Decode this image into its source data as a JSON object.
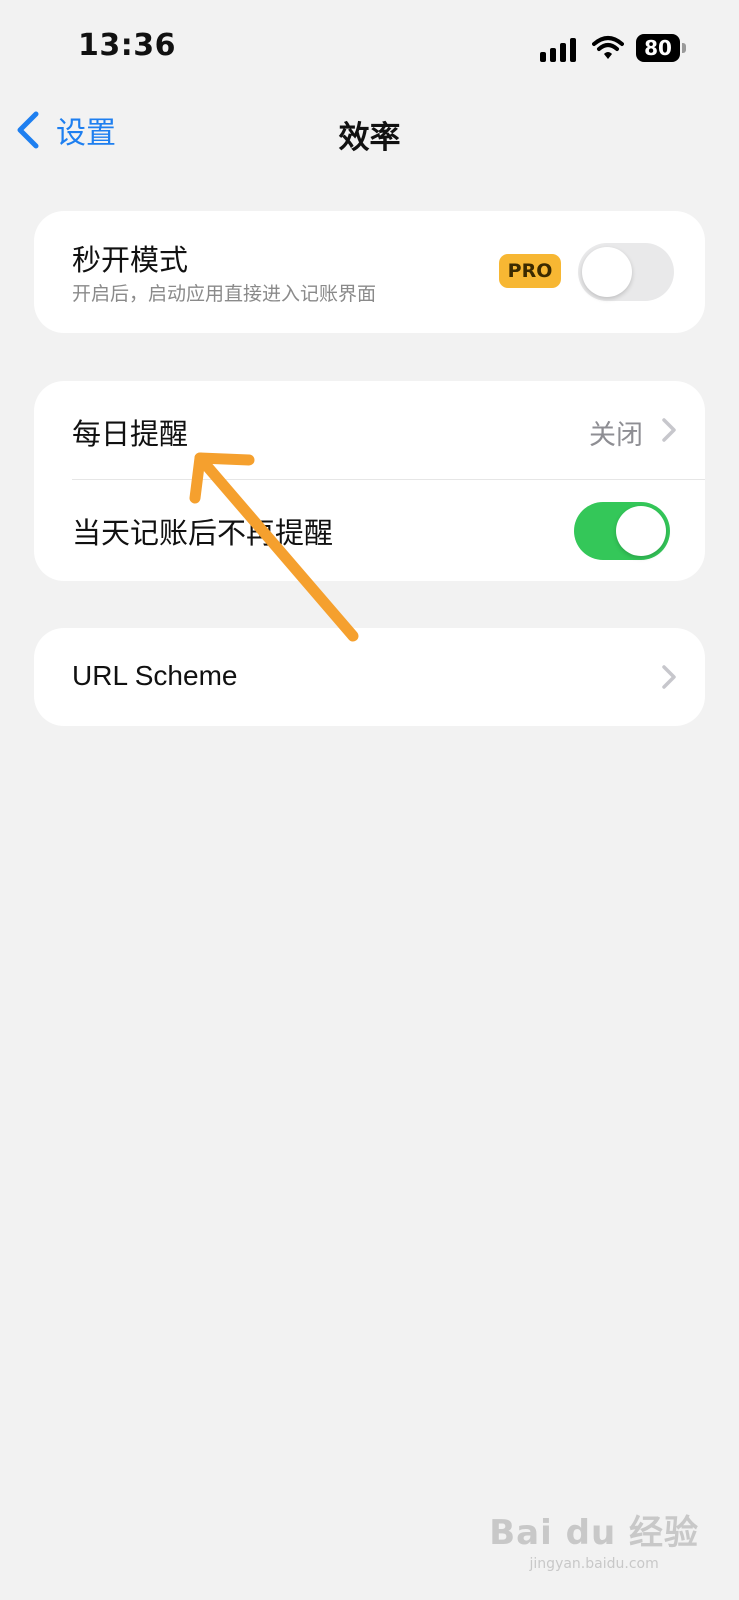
{
  "status_bar": {
    "time": "13:36",
    "battery": "80",
    "signal_icon": "signal-bars-icon",
    "wifi_icon": "wifi-icon"
  },
  "nav": {
    "back_label": "设置",
    "title": "效率"
  },
  "sections": {
    "quick_open": {
      "title": "秒开模式",
      "subtitle": "开启后，启动应用直接进入记账界面",
      "badge": "PRO",
      "enabled": false
    },
    "reminder": {
      "daily_title": "每日提醒",
      "daily_value": "关闭",
      "skip_title": "当天记账后不再提醒",
      "skip_enabled": true
    },
    "url_scheme": {
      "title": "URL Scheme"
    }
  },
  "watermark": {
    "logo": "Bai du 经验",
    "sub": "jingyan.baidu.com"
  },
  "colors": {
    "accent": "#1e7ff0",
    "toggle_on": "#34c759",
    "pro_badge": "#f7b733",
    "annotation_arrow": "#f5a02e",
    "background": "#f2f2f2"
  }
}
